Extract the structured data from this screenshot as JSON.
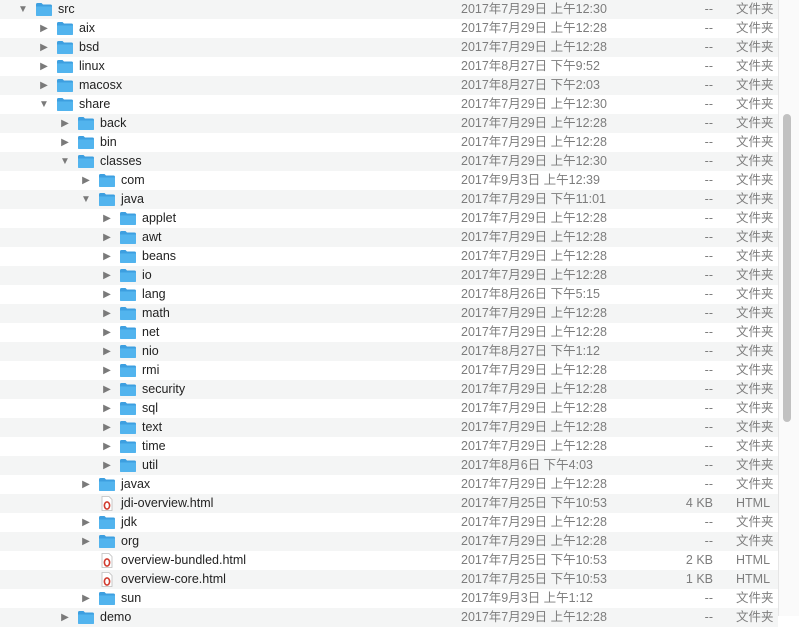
{
  "rows": [
    {
      "name": "src",
      "date": "2017年7月29日 上午12:30",
      "size": "--",
      "kind": "文件夹",
      "depth": 0,
      "expander": "open",
      "type": "folder"
    },
    {
      "name": "aix",
      "date": "2017年7月29日 上午12:28",
      "size": "--",
      "kind": "文件夹",
      "depth": 1,
      "expander": "closed",
      "type": "folder"
    },
    {
      "name": "bsd",
      "date": "2017年7月29日 上午12:28",
      "size": "--",
      "kind": "文件夹",
      "depth": 1,
      "expander": "closed",
      "type": "folder"
    },
    {
      "name": "linux",
      "date": "2017年8月27日 下午9:52",
      "size": "--",
      "kind": "文件夹",
      "depth": 1,
      "expander": "closed",
      "type": "folder"
    },
    {
      "name": "macosx",
      "date": "2017年8月27日 下午2:03",
      "size": "--",
      "kind": "文件夹",
      "depth": 1,
      "expander": "closed",
      "type": "folder"
    },
    {
      "name": "share",
      "date": "2017年7月29日 上午12:30",
      "size": "--",
      "kind": "文件夹",
      "depth": 1,
      "expander": "open",
      "type": "folder"
    },
    {
      "name": "back",
      "date": "2017年7月29日 上午12:28",
      "size": "--",
      "kind": "文件夹",
      "depth": 2,
      "expander": "closed",
      "type": "folder"
    },
    {
      "name": "bin",
      "date": "2017年7月29日 上午12:28",
      "size": "--",
      "kind": "文件夹",
      "depth": 2,
      "expander": "closed",
      "type": "folder"
    },
    {
      "name": "classes",
      "date": "2017年7月29日 上午12:30",
      "size": "--",
      "kind": "文件夹",
      "depth": 2,
      "expander": "open",
      "type": "folder"
    },
    {
      "name": "com",
      "date": "2017年9月3日 上午12:39",
      "size": "--",
      "kind": "文件夹",
      "depth": 3,
      "expander": "closed",
      "type": "folder"
    },
    {
      "name": "java",
      "date": "2017年7月29日 下午11:01",
      "size": "--",
      "kind": "文件夹",
      "depth": 3,
      "expander": "open",
      "type": "folder"
    },
    {
      "name": "applet",
      "date": "2017年7月29日 上午12:28",
      "size": "--",
      "kind": "文件夹",
      "depth": 4,
      "expander": "closed",
      "type": "folder"
    },
    {
      "name": "awt",
      "date": "2017年7月29日 上午12:28",
      "size": "--",
      "kind": "文件夹",
      "depth": 4,
      "expander": "closed",
      "type": "folder"
    },
    {
      "name": "beans",
      "date": "2017年7月29日 上午12:28",
      "size": "--",
      "kind": "文件夹",
      "depth": 4,
      "expander": "closed",
      "type": "folder"
    },
    {
      "name": "io",
      "date": "2017年7月29日 上午12:28",
      "size": "--",
      "kind": "文件夹",
      "depth": 4,
      "expander": "closed",
      "type": "folder"
    },
    {
      "name": "lang",
      "date": "2017年8月26日 下午5:15",
      "size": "--",
      "kind": "文件夹",
      "depth": 4,
      "expander": "closed",
      "type": "folder"
    },
    {
      "name": "math",
      "date": "2017年7月29日 上午12:28",
      "size": "--",
      "kind": "文件夹",
      "depth": 4,
      "expander": "closed",
      "type": "folder"
    },
    {
      "name": "net",
      "date": "2017年7月29日 上午12:28",
      "size": "--",
      "kind": "文件夹",
      "depth": 4,
      "expander": "closed",
      "type": "folder"
    },
    {
      "name": "nio",
      "date": "2017年8月27日 下午1:12",
      "size": "--",
      "kind": "文件夹",
      "depth": 4,
      "expander": "closed",
      "type": "folder"
    },
    {
      "name": "rmi",
      "date": "2017年7月29日 上午12:28",
      "size": "--",
      "kind": "文件夹",
      "depth": 4,
      "expander": "closed",
      "type": "folder"
    },
    {
      "name": "security",
      "date": "2017年7月29日 上午12:28",
      "size": "--",
      "kind": "文件夹",
      "depth": 4,
      "expander": "closed",
      "type": "folder"
    },
    {
      "name": "sql",
      "date": "2017年7月29日 上午12:28",
      "size": "--",
      "kind": "文件夹",
      "depth": 4,
      "expander": "closed",
      "type": "folder"
    },
    {
      "name": "text",
      "date": "2017年7月29日 上午12:28",
      "size": "--",
      "kind": "文件夹",
      "depth": 4,
      "expander": "closed",
      "type": "folder"
    },
    {
      "name": "time",
      "date": "2017年7月29日 上午12:28",
      "size": "--",
      "kind": "文件夹",
      "depth": 4,
      "expander": "closed",
      "type": "folder"
    },
    {
      "name": "util",
      "date": "2017年8月6日 下午4:03",
      "size": "--",
      "kind": "文件夹",
      "depth": 4,
      "expander": "closed",
      "type": "folder"
    },
    {
      "name": "javax",
      "date": "2017年7月29日 上午12:28",
      "size": "--",
      "kind": "文件夹",
      "depth": 3,
      "expander": "closed",
      "type": "folder"
    },
    {
      "name": "jdi-overview.html",
      "date": "2017年7月25日 下午10:53",
      "size": "4 KB",
      "kind": "HTML",
      "depth": 3,
      "expander": "none",
      "type": "html"
    },
    {
      "name": "jdk",
      "date": "2017年7月29日 上午12:28",
      "size": "--",
      "kind": "文件夹",
      "depth": 3,
      "expander": "closed",
      "type": "folder"
    },
    {
      "name": "org",
      "date": "2017年7月29日 上午12:28",
      "size": "--",
      "kind": "文件夹",
      "depth": 3,
      "expander": "closed",
      "type": "folder"
    },
    {
      "name": "overview-bundled.html",
      "date": "2017年7月25日 下午10:53",
      "size": "2 KB",
      "kind": "HTML",
      "depth": 3,
      "expander": "none",
      "type": "html"
    },
    {
      "name": "overview-core.html",
      "date": "2017年7月25日 下午10:53",
      "size": "1 KB",
      "kind": "HTML",
      "depth": 3,
      "expander": "none",
      "type": "html"
    },
    {
      "name": "sun",
      "date": "2017年9月3日 上午1:12",
      "size": "--",
      "kind": "文件夹",
      "depth": 3,
      "expander": "closed",
      "type": "folder"
    },
    {
      "name": "demo",
      "date": "2017年7月29日 上午12:28",
      "size": "--",
      "kind": "文件夹",
      "depth": 2,
      "expander": "closed",
      "type": "folder"
    }
  ],
  "colors": {
    "folder": "#52b4ee",
    "folder_dark": "#3d9fe0",
    "html_icon": "#d13b2e"
  },
  "icons": {
    "folder": "folder-icon",
    "html": "html-file-icon",
    "expanded": "disclosure-triangle-down-icon",
    "collapsed": "disclosure-triangle-right-icon"
  },
  "scrollbar": {
    "visible_fraction": 0.5,
    "scroll_position_fraction": 0.37
  }
}
